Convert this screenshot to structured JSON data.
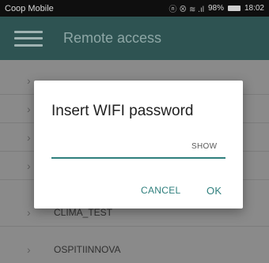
{
  "status_bar": {
    "carrier": "Coop Mobile",
    "icons": "ⓝ ⊗ ≋ .ıl",
    "battery": "98%",
    "time": "18:02"
  },
  "app_bar": {
    "menu_icon": "hamburger-menu",
    "title": "Remote access"
  },
  "list": {
    "items": [
      {
        "label": ""
      },
      {
        "label": ""
      },
      {
        "label": ""
      },
      {
        "label": ""
      },
      {
        "label": "CLIMA_TEST"
      },
      {
        "label": "OSPITIINNOVA"
      }
    ]
  },
  "dialog": {
    "title": "Insert WIFI password",
    "input_value": "",
    "show_label": "SHOW",
    "cancel_label": "CANCEL",
    "ok_label": "OK"
  },
  "colors": {
    "app_bar": "#2e5352",
    "accent": "#2f7f7d",
    "scrim_background": "#8a8a8a"
  }
}
